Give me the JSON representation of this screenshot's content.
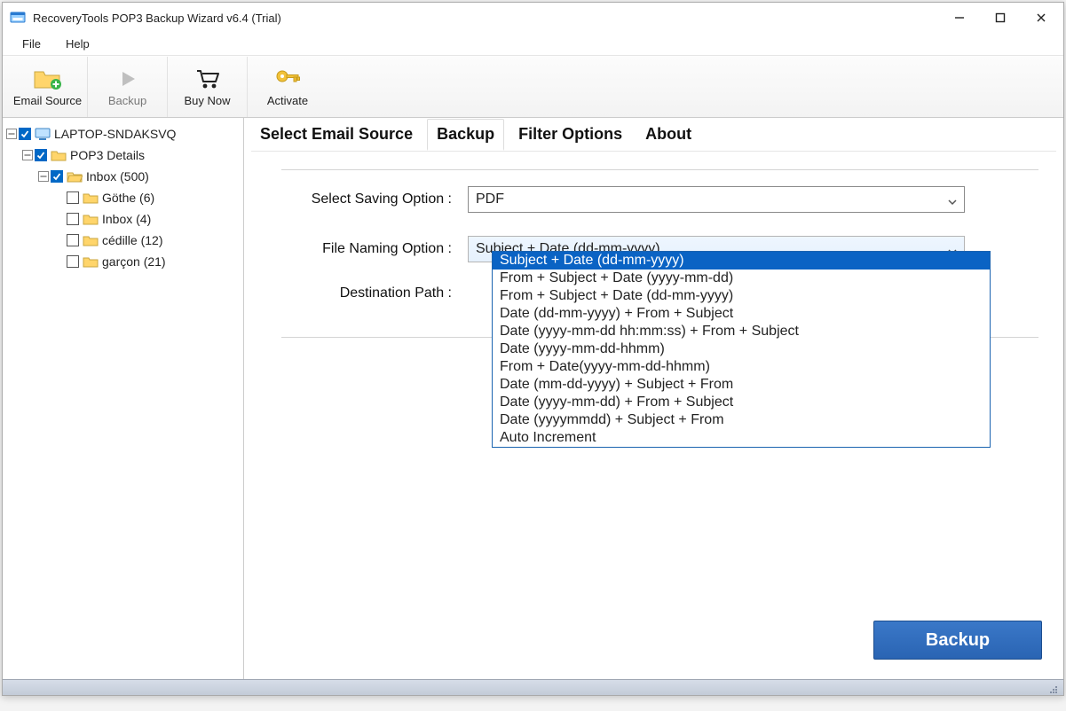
{
  "title": "RecoveryTools POP3 Backup Wizard v6.4 (Trial)",
  "menu": {
    "file": "File",
    "help": "Help"
  },
  "toolbar": {
    "email_source": "Email Source",
    "backup": "Backup",
    "buy_now": "Buy Now",
    "activate": "Activate"
  },
  "tree": {
    "root": "LAPTOP-SNDAKSVQ",
    "pop3": "POP3 Details",
    "inbox": "Inbox (500)",
    "children": [
      "Göthe (6)",
      "Inbox (4)",
      "cédille (12)",
      "garçon (21)"
    ]
  },
  "tabs": {
    "select_source": "Select Email Source",
    "backup": "Backup",
    "filter": "Filter Options",
    "about": "About"
  },
  "form": {
    "saving_label": "Select Saving Option :",
    "saving_value": "PDF",
    "naming_label": "File Naming Option :",
    "naming_value": "Subject + Date (dd-mm-yyyy)",
    "dest_label": "Destination Path :"
  },
  "naming_options": [
    "Subject + Date (dd-mm-yyyy)",
    "From + Subject + Date (yyyy-mm-dd)",
    "From + Subject + Date (dd-mm-yyyy)",
    "Date (dd-mm-yyyy) + From + Subject",
    "Date (yyyy-mm-dd hh:mm:ss) + From + Subject",
    "Date (yyyy-mm-dd-hhmm)",
    "From + Date(yyyy-mm-dd-hhmm)",
    "Date (mm-dd-yyyy) + Subject + From",
    "Date (yyyy-mm-dd) + From + Subject",
    "Date (yyyymmdd) + Subject + From",
    "Auto Increment"
  ],
  "backup_button": "Backup"
}
